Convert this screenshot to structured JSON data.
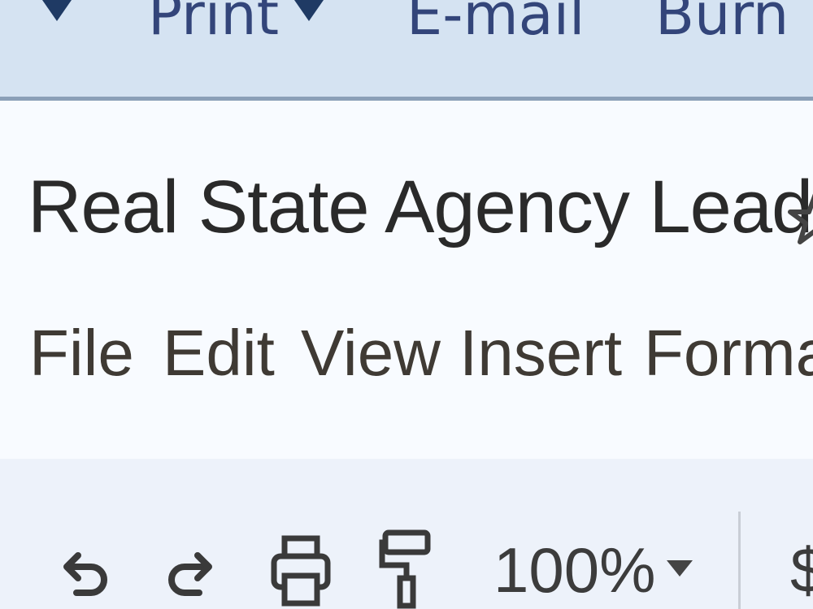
{
  "topbar": {
    "items": [
      {
        "label": "Print"
      },
      {
        "label": "E-mail"
      },
      {
        "label": "Burn"
      }
    ],
    "colors": {
      "background": "#d5e3f2",
      "text": "#33457a",
      "arrow": "#1f3a64"
    }
  },
  "document": {
    "title": "Real State Agency Leads",
    "star_icon": "star-outline-icon"
  },
  "menu": {
    "items": [
      "File",
      "Edit",
      "View",
      "Insert",
      "Format"
    ]
  },
  "toolbar": {
    "undo_icon": "undo-icon",
    "redo_icon": "redo-icon",
    "print_icon": "print-icon",
    "paint_format_icon": "paint-format-icon",
    "zoom": "100%",
    "currency": "$"
  }
}
